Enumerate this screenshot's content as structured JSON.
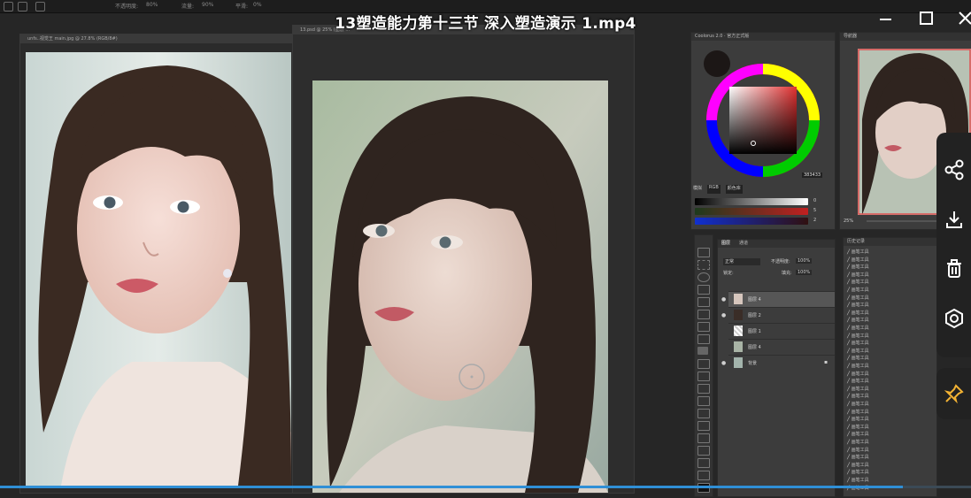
{
  "video": {
    "title": "13塑造能力第十三节 深入塑造演示 1.mp4",
    "progress": 0.93
  },
  "photoshop": {
    "options_bar": {
      "opacity_label": "不透明度:",
      "opacity_value": "80%",
      "flow_label": "流量:",
      "flow_value": "90%",
      "smooth_label": "平滑:",
      "smooth_value": "0%"
    },
    "doc_tabs": {
      "reference": "unfs..视觉王 main.jpg @ 27.8% (RGB/8#)",
      "painting": "13.psd @ 25% (图层 ..."
    },
    "color_panel": {
      "title": "Coolorus 2.0 · 官方正式版",
      "hex": "383433",
      "mode_buttons": [
        "模拟",
        "RGB",
        "颜色库"
      ],
      "slider_values": [
        "0",
        "5",
        "2"
      ]
    },
    "navigator": {
      "title": "导航器",
      "zoom": "25%"
    },
    "layers_panel": {
      "tabs": [
        "图层",
        "通道"
      ],
      "blend_mode": "正常",
      "opacity_label": "不透明度:",
      "opacity_value": "100%",
      "lock_label": "锁定:",
      "fill_label": "填充:",
      "fill_value": "100%",
      "layers": [
        {
          "name": "图层 4",
          "selected": true
        },
        {
          "name": "图层 2",
          "selected": false
        },
        {
          "name": "图层 1",
          "selected": false
        },
        {
          "name": "图层 4",
          "selected": false
        },
        {
          "name": "背景",
          "selected": false
        }
      ]
    },
    "history_panel": {
      "title": "历史记录",
      "items": [
        "画笔工具",
        "画笔工具",
        "画笔工具",
        "画笔工具",
        "画笔工具",
        "画笔工具",
        "画笔工具",
        "画笔工具",
        "画笔工具",
        "画笔工具",
        "画笔工具",
        "画笔工具",
        "画笔工具",
        "画笔工具",
        "画笔工具",
        "画笔工具",
        "画笔工具",
        "画笔工具",
        "画笔工具",
        "画笔工具",
        "画笔工具",
        "画笔工具",
        "画笔工具",
        "画笔工具",
        "画笔工具",
        "画笔工具",
        "画笔工具",
        "画笔工具",
        "画笔工具",
        "画笔工具",
        "画笔工具",
        "画笔工具"
      ]
    }
  },
  "colors": {
    "accent_blue": "#2f8fd6",
    "ps_dark": "#262626",
    "panel": "#3c3c3c",
    "selection_border": "#e05050"
  },
  "icons": {
    "share": "share-icon",
    "download": "download-icon",
    "delete": "trash-icon",
    "settings": "settings-icon",
    "pin": "pin-icon"
  }
}
